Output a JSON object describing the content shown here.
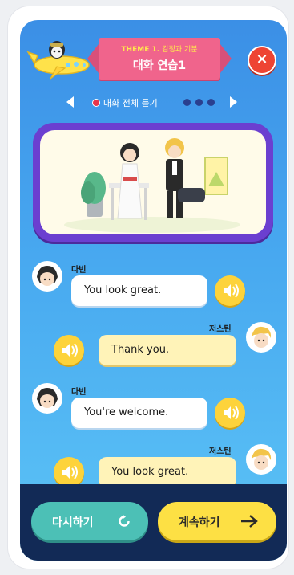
{
  "header": {
    "theme_prefix": "THEME 1.",
    "theme_subtitle": "감정과 기분",
    "title": "대화 연습1",
    "close_label": "×"
  },
  "nav": {
    "label": "대화 전체 듣기"
  },
  "chat": [
    {
      "speaker": "다빈",
      "text": "You look great.",
      "side": "left"
    },
    {
      "speaker": "저스틴",
      "text": "Thank you.",
      "side": "right"
    },
    {
      "speaker": "다빈",
      "text": "You're welcome.",
      "side": "left"
    },
    {
      "speaker": "저스틴",
      "text": "You look great.",
      "side": "right"
    }
  ],
  "footer": {
    "retry_label": "다시하기",
    "continue_label": "계속하기"
  },
  "colors": {
    "bg_top": "#3b8fe6",
    "banner": "#f0648c",
    "card_border": "#6b3fd0",
    "sound_button": "#fdd33b",
    "retry_button": "#4cc0b6",
    "continue_button": "#fde044",
    "bottom_bar": "#122a56"
  },
  "icons": {
    "close": "close-icon",
    "prev": "arrow-left-icon",
    "next": "arrow-right-icon",
    "sound": "speaker-icon",
    "retry": "retry-icon",
    "continue": "arrow-right-icon"
  }
}
